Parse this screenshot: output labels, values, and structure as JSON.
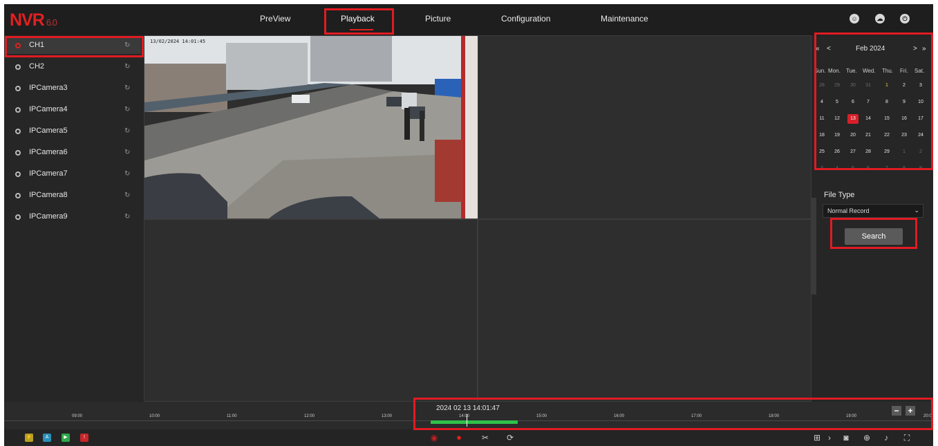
{
  "header": {
    "logo": "NVR",
    "version": "6.0",
    "nav": [
      "PreView",
      "Playback",
      "Picture",
      "Configuration",
      "Maintenance"
    ],
    "active_nav": "Playback"
  },
  "channels": [
    {
      "label": "CH1"
    },
    {
      "label": "CH2"
    },
    {
      "label": "IPCamera3"
    },
    {
      "label": "IPCamera4"
    },
    {
      "label": "IPCamera5"
    },
    {
      "label": "IPCamera6"
    },
    {
      "label": "IPCamera7"
    },
    {
      "label": "IPCamera8"
    },
    {
      "label": "IPCamera9"
    }
  ],
  "active_channel": "CH1",
  "video": {
    "osd_timestamp": "13/02/2024 14:01:45"
  },
  "calendar": {
    "month_year": "Feb 2024",
    "weekdays": [
      "Sun.",
      "Mon.",
      "Tue.",
      "Wed.",
      "Thu.",
      "Fri.",
      "Sat."
    ],
    "days": [
      [
        "28",
        "29",
        "30",
        "31",
        "1",
        "2",
        "3"
      ],
      [
        "4",
        "5",
        "6",
        "7",
        "8",
        "9",
        "10"
      ],
      [
        "11",
        "12",
        "13",
        "14",
        "15",
        "16",
        "17"
      ],
      [
        "18",
        "19",
        "20",
        "21",
        "22",
        "23",
        "24"
      ],
      [
        "25",
        "26",
        "27",
        "28",
        "29",
        "1",
        "2"
      ],
      [
        "3",
        "4",
        "5",
        "6",
        "7",
        "8",
        "9"
      ]
    ],
    "selected_day": "13",
    "prev_year": "«",
    "prev_month": "<",
    "next_month": ">",
    "next_year": "»"
  },
  "file_type": {
    "label": "File Type",
    "value": "Normal Record"
  },
  "search_label": "Search",
  "timeline": {
    "current_time": "2024 02 13 14:01:47",
    "ticks": [
      "09:00",
      "10:00",
      "11:00",
      "12:00",
      "13:00",
      "14:00",
      "15:00",
      "16:00",
      "17:00",
      "18:00",
      "19:00",
      "20:0"
    ],
    "zoom_out": "−",
    "zoom_in": "+"
  },
  "colors": {
    "accent": "#e02020",
    "highlight": "#e11b22",
    "record_bar": "#2fc24a",
    "background": "#2b2b2b"
  }
}
